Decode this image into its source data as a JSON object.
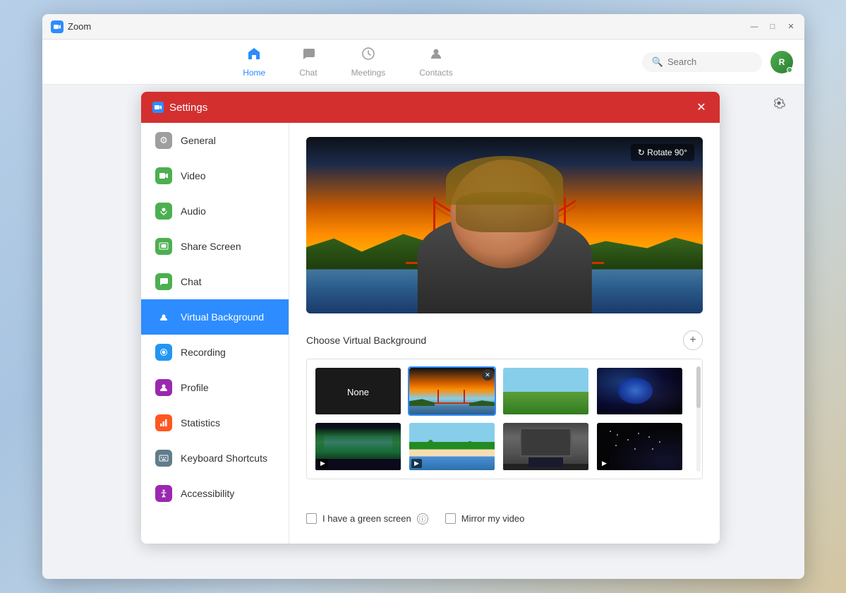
{
  "app": {
    "title": "Zoom",
    "window_controls": {
      "minimize": "—",
      "maximize": "□",
      "close": "✕"
    }
  },
  "navbar": {
    "tabs": [
      {
        "id": "home",
        "label": "Home",
        "icon": "⌂",
        "active": true
      },
      {
        "id": "chat",
        "label": "Chat",
        "icon": "💬",
        "active": false
      },
      {
        "id": "meetings",
        "label": "Meetings",
        "icon": "🕐",
        "active": false
      },
      {
        "id": "contacts",
        "label": "Contacts",
        "icon": "👤",
        "active": false
      }
    ],
    "search_placeholder": "Search",
    "avatar_initials": "R"
  },
  "settings": {
    "title": "Settings",
    "close_label": "✕",
    "sidebar": [
      {
        "id": "general",
        "label": "General",
        "icon": "⚙",
        "icon_class": "icon-general"
      },
      {
        "id": "video",
        "label": "Video",
        "icon": "📷",
        "icon_class": "icon-video"
      },
      {
        "id": "audio",
        "label": "Audio",
        "icon": "🎧",
        "icon_class": "icon-audio"
      },
      {
        "id": "share-screen",
        "label": "Share Screen",
        "icon": "▣",
        "icon_class": "icon-share"
      },
      {
        "id": "chat",
        "label": "Chat",
        "icon": "💬",
        "icon_class": "icon-chat"
      },
      {
        "id": "virtual-background",
        "label": "Virtual Background",
        "icon": "👤",
        "icon_class": "icon-vbg",
        "active": true
      },
      {
        "id": "recording",
        "label": "Recording",
        "icon": "⏺",
        "icon_class": "icon-recording"
      },
      {
        "id": "profile",
        "label": "Profile",
        "icon": "👤",
        "icon_class": "icon-profile"
      },
      {
        "id": "statistics",
        "label": "Statistics",
        "icon": "📊",
        "icon_class": "icon-stats"
      },
      {
        "id": "keyboard-shortcuts",
        "label": "Keyboard Shortcuts",
        "icon": "⌨",
        "icon_class": "icon-keyboard"
      },
      {
        "id": "accessibility",
        "label": "Accessibility",
        "icon": "♿",
        "icon_class": "icon-accessibility"
      }
    ],
    "content": {
      "rotate_btn_label": "↻ Rotate 90°",
      "vbg_section_label": "Choose Virtual Background",
      "add_btn_label": "+",
      "thumbnails": [
        {
          "id": "none",
          "type": "none",
          "label": "None",
          "selected": false
        },
        {
          "id": "bridge",
          "type": "bridge",
          "label": "Golden Gate Bridge",
          "selected": true
        },
        {
          "id": "grass",
          "type": "grass",
          "label": "Grass Field",
          "selected": false
        },
        {
          "id": "space",
          "type": "space",
          "label": "Space",
          "selected": false
        },
        {
          "id": "aurora",
          "type": "aurora",
          "label": "Aurora",
          "selected": false
        },
        {
          "id": "beach",
          "type": "beach",
          "label": "Beach",
          "selected": false
        },
        {
          "id": "garage",
          "type": "garage",
          "label": "Garage",
          "selected": false
        },
        {
          "id": "dark",
          "type": "dark",
          "label": "Dark Space",
          "selected": false
        }
      ],
      "green_screen_label": "I have a green screen",
      "mirror_label": "Mirror my video",
      "green_screen_checked": false,
      "mirror_checked": false
    }
  }
}
